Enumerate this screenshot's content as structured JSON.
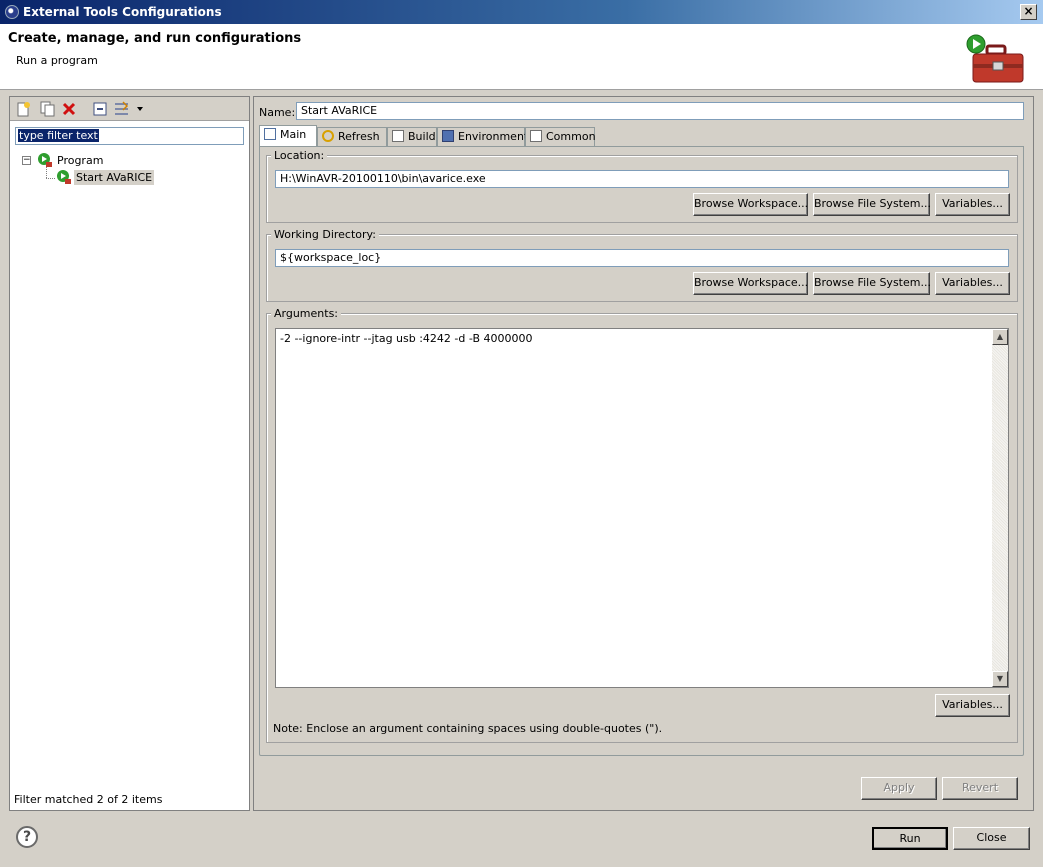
{
  "window": {
    "title": "External Tools Configurations",
    "close_glyph": "×"
  },
  "header": {
    "title": "Create, manage, and run configurations",
    "subtitle": "Run a program"
  },
  "left": {
    "filter_text": "type filter text",
    "tree": {
      "category": "Program",
      "item": "Start AVaRICE",
      "collapse_glyph": "−"
    },
    "status": "Filter matched 2 of 2 items",
    "toolbar": [
      "new-config-icon",
      "duplicate-icon",
      "delete-icon",
      "collapse-all-icon",
      "filter-icon",
      "view-menu-icon"
    ]
  },
  "right": {
    "name_label": "Name:",
    "name_value": "Start AVaRICE",
    "tabs": [
      "Main",
      "Refresh",
      "Build",
      "Environment",
      "Common"
    ],
    "location": {
      "label": "Location:",
      "value": "H:\\WinAVR-20100110\\bin\\avarice.exe",
      "btn_workspace": "Browse Workspace...",
      "btn_filesystem": "Browse File System...",
      "btn_variables": "Variables..."
    },
    "workdir": {
      "label": "Working Directory:",
      "value": "${workspace_loc}",
      "btn_workspace": "Browse Workspace...",
      "btn_filesystem": "Browse File System...",
      "btn_variables": "Variables..."
    },
    "arguments": {
      "label": "Arguments:",
      "value": "-2 --ignore-intr --jtag usb :4242 -d -B 4000000",
      "btn_variables": "Variables...",
      "note": "Note: Enclose an argument containing spaces using double-quotes (\")."
    },
    "apply": "Apply",
    "revert": "Revert"
  },
  "footer": {
    "run": "Run",
    "close": "Close",
    "help_glyph": "?"
  },
  "colors": {
    "titlebar": "#0a246a",
    "panel": "#d4d0c8",
    "selection": "#0a246a"
  }
}
